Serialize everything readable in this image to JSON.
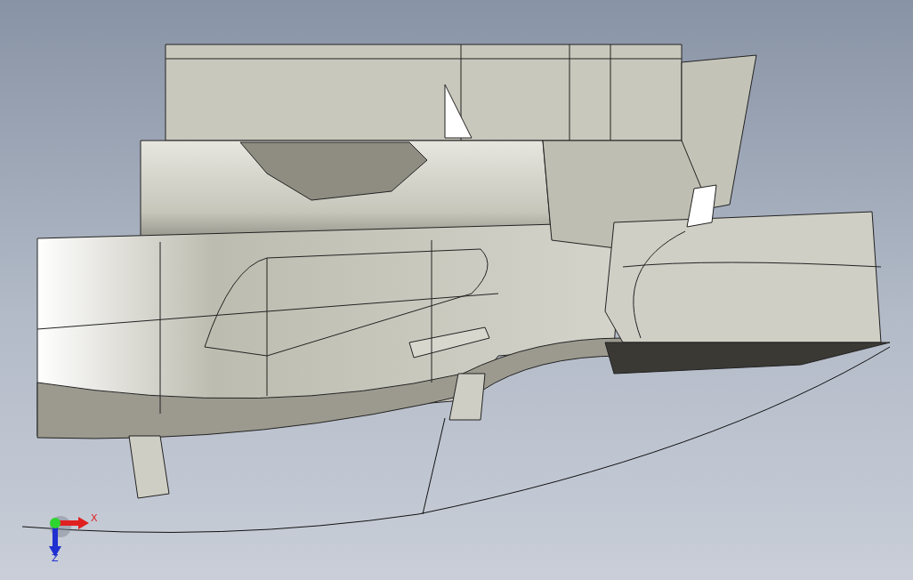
{
  "viewport": {
    "triad": {
      "axes": [
        {
          "kind": "x",
          "label": "X",
          "color": "#e02020"
        },
        {
          "kind": "z",
          "label": "Z",
          "color": "#1f2fd0"
        }
      ]
    }
  }
}
